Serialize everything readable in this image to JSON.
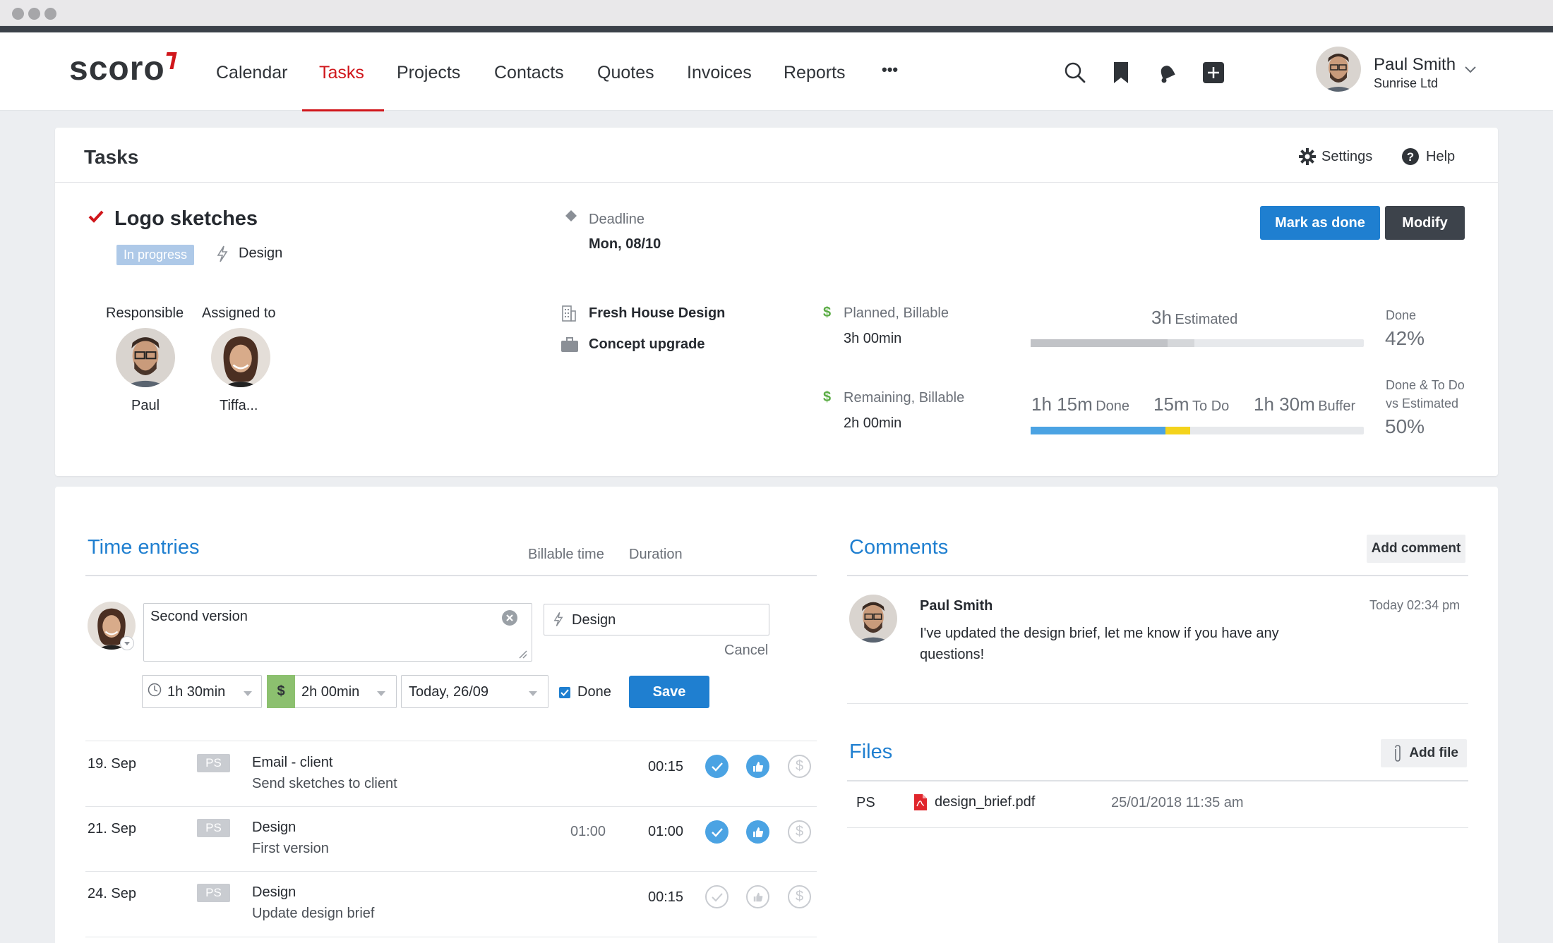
{
  "window": {
    "controls": [
      "close",
      "minimize",
      "maximize"
    ]
  },
  "nav": {
    "logo": "scoro",
    "items": [
      {
        "label": "Calendar"
      },
      {
        "label": "Tasks",
        "active": true
      },
      {
        "label": "Projects"
      },
      {
        "label": "Contacts"
      },
      {
        "label": "Quotes"
      },
      {
        "label": "Invoices"
      },
      {
        "label": "Reports"
      },
      {
        "label": "•••"
      }
    ],
    "icons": [
      "search-icon",
      "bookmark-icon",
      "bell-icon",
      "plus-icon"
    ],
    "user": {
      "name": "Paul Smith",
      "company": "Sunrise Ltd"
    }
  },
  "page": {
    "title": "Tasks",
    "settings_label": "Settings",
    "help_label": "Help"
  },
  "task": {
    "title": "Logo sketches",
    "status": "In progress",
    "activity": "Design",
    "deadline_label": "Deadline",
    "deadline_value": "Mon, 08/10",
    "mark_done_label": "Mark as done",
    "modify_label": "Modify",
    "responsible_label": "Responsible",
    "responsible_name": "Paul",
    "assigned_label": "Assigned to",
    "assigned_name": "Tiffa...",
    "company": "Fresh House Design",
    "project": "Concept upgrade",
    "planned_label": "Planned, Billable",
    "planned_value": "3h 00min",
    "remaining_label": "Remaining, Billable",
    "remaining_value": "2h 00min",
    "estimated_value": "3h",
    "estimated_label": "Estimated",
    "done_label": "Done",
    "done_pct": "42%",
    "done_todo_label_1": "Done & To Do",
    "done_todo_label_2": "vs Estimated",
    "done_todo_pct": "50%",
    "done_time": "1h 15m",
    "done_time_label": "Done",
    "todo_time": "15m",
    "todo_time_label": "To Do",
    "buffer_time": "1h 30m",
    "buffer_time_label": "Buffer",
    "bar1": {
      "done_fraction": 0.41,
      "extra_fraction": 0.08
    },
    "bar2": {
      "done_fraction": 0.405,
      "todo_fraction": 0.075
    },
    "colors": {
      "accent": "#1f7fd0",
      "brand": "#d0161b",
      "done_bar": "#4ba3e3",
      "todo_bar": "#f4d31c",
      "billable_green": "#5aac44"
    }
  },
  "time_entries": {
    "title": "Time entries",
    "col_billable": "Billable time",
    "col_duration": "Duration",
    "form": {
      "description": "Second version",
      "activity": "Design",
      "cancel_label": "Cancel",
      "duration": "1h 30min",
      "billable": "2h 00min",
      "billable_symbol": "$",
      "date": "Today, 26/09",
      "done_label": "Done",
      "done_checked": true,
      "save_label": "Save"
    },
    "rows": [
      {
        "date": "19. Sep",
        "user": "PS",
        "activity": "Email - client",
        "desc": "Send sketches to client",
        "billable": "",
        "duration": "00:15",
        "approved": true
      },
      {
        "date": "21. Sep",
        "user": "PS",
        "activity": "Design",
        "desc": "First version",
        "billable": "01:00",
        "duration": "01:00",
        "approved": true
      },
      {
        "date": "24. Sep",
        "user": "PS",
        "activity": "Design",
        "desc": "Update design brief",
        "billable": "",
        "duration": "00:15",
        "approved": false
      }
    ]
  },
  "comments": {
    "title": "Comments",
    "add_label": "Add comment",
    "items": [
      {
        "author": "Paul Smith",
        "time": "Today 02:34 pm",
        "text_1": "I've updated the design brief, let me know if you have any",
        "text_2": "questions!"
      }
    ]
  },
  "files": {
    "title": "Files",
    "add_label": "Add file",
    "items": [
      {
        "user": "PS",
        "name": "design_brief.pdf",
        "date": "25/01/2018 11:35 am"
      }
    ]
  }
}
